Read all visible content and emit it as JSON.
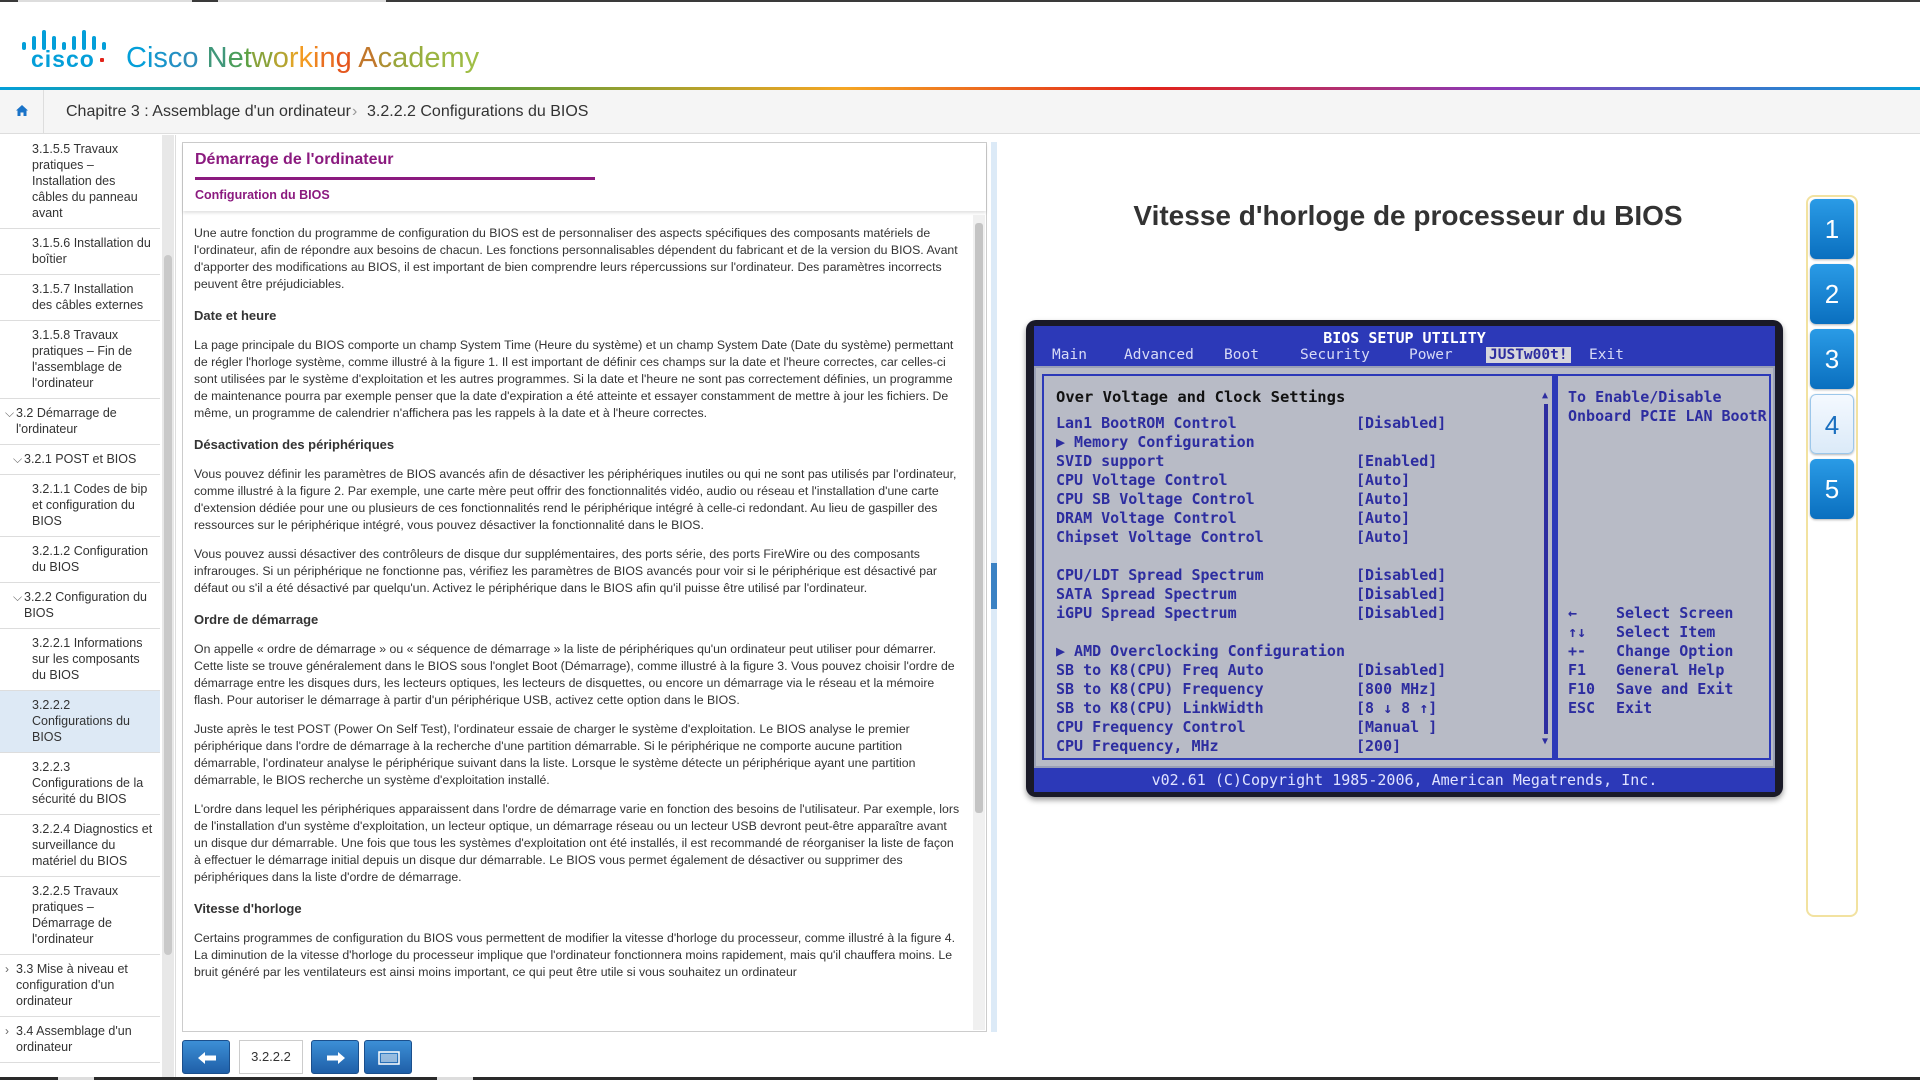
{
  "header": {
    "logo_word": "cisco",
    "academy_title": "Cisco Networking Academy",
    "brand_color": "#049fd9"
  },
  "breadcrumb": {
    "home_icon": "home-icon",
    "chapter": "Chapitre 3 : Assemblage d'un ordinateur",
    "separator": "›",
    "section": "3.2.2.2 Configurations du BIOS"
  },
  "sidebar": {
    "items": [
      {
        "label": "3.1.5.5 Travaux pratiques – Installation des câbles du panneau avant"
      },
      {
        "label": "3.1.5.6 Installation du boîtier"
      },
      {
        "label": "3.1.5.7 Installation des câbles externes"
      },
      {
        "label": "3.1.5.8 Travaux pratiques – Fin de l'assemblage de l'ordinateur"
      },
      {
        "label": "3.2 Démarrage de l'ordinateur",
        "chev": "⌵"
      },
      {
        "label": "3.2.1 POST et BIOS",
        "chev": "⌵"
      },
      {
        "label": "3.2.1.1 Codes de bip et configuration du BIOS"
      },
      {
        "label": "3.2.1.2 Configuration du BIOS"
      },
      {
        "label": "3.2.2 Configuration du BIOS",
        "chev": "⌵"
      },
      {
        "label": "3.2.2.1 Informations sur les composants du BIOS"
      },
      {
        "label": "3.2.2.2 Configurations du BIOS"
      },
      {
        "label": "3.2.2.3 Configurations de la sécurité du BIOS"
      },
      {
        "label": "3.2.2.4 Diagnostics et surveillance du matériel du BIOS"
      },
      {
        "label": "3.2.2.5 Travaux pratiques – Démarrage de l'ordinateur"
      },
      {
        "label": "3.3 Mise à niveau et configuration d'un ordinateur",
        "chev": "›"
      },
      {
        "label": "3.4 Assemblage d'un ordinateur",
        "chev": "›"
      }
    ]
  },
  "content": {
    "title": "Démarrage de l'ordinateur",
    "subtitle": "Configuration du BIOS",
    "p1": "Une autre fonction du programme de configuration du BIOS est de personnaliser des aspects spécifiques des composants matériels de l'ordinateur, afin de répondre aux besoins de chacun. Les fonctions personnalisables dépendent du fabricant et de la version du BIOS. Avant d'apporter des modifications au BIOS, il est important de bien comprendre leurs répercussions sur l'ordinateur. Des paramètres incorrects peuvent être préjudiciables.",
    "h1": "Date et heure",
    "p2": "La page principale du BIOS comporte un champ System Time (Heure du système) et un champ System Date (Date du système) permettant de régler l'horloge système, comme illustré à la figure 1. Il est important de définir ces champs sur la date et l'heure correctes, car celles-ci sont utilisées par le système d'exploitation et les autres programmes. Si la date et l'heure ne sont pas correctement définies, un programme de maintenance pourra par exemple penser que la date d'expiration a été atteinte et essayer constamment de mettre à jour les fichiers. De même, un programme de calendrier n'affichera pas les rappels à la date et à l'heure correctes.",
    "h2": "Désactivation des périphériques",
    "p3": "Vous pouvez définir les paramètres de BIOS avancés afin de désactiver les périphériques inutiles ou qui ne sont pas utilisés par l'ordinateur, comme illustré à la figure 2. Par exemple, une carte mère peut offrir des fonctionnalités vidéo, audio ou réseau et l'installation d'une carte d'extension dédiée pour une ou plusieurs de ces fonctionnalités rend le périphérique intégré à celle-ci redondant. Au lieu de gaspiller des ressources sur le périphérique intégré, vous pouvez désactiver la fonctionnalité dans le BIOS.",
    "p4": "Vous pouvez aussi désactiver des contrôleurs de disque dur supplémentaires, des ports série, des ports FireWire ou des composants infrarouges. Si un périphérique ne fonctionne pas, vérifiez les paramètres de BIOS avancés pour voir si le périphérique est désactivé par défaut ou s'il a été désactivé par quelqu'un. Activez le périphérique dans le BIOS afin qu'il puisse être utilisé par l'ordinateur.",
    "h3": "Ordre de démarrage",
    "p5": "On appelle « ordre de démarrage » ou « séquence de démarrage » la liste de périphériques qu'un ordinateur peut utiliser pour démarrer. Cette liste se trouve généralement dans le BIOS sous l'onglet Boot (Démarrage), comme illustré à la figure 3. Vous pouvez choisir l'ordre de démarrage entre les disques durs, les lecteurs optiques, les lecteurs de disquettes, ou encore un démarrage via le réseau et la mémoire flash. Pour autoriser le démarrage à partir d'un périphérique USB, activez cette option dans le BIOS.",
    "p6": "Juste après le test POST (Power On Self Test), l'ordinateur essaie de charger le système d'exploitation. Le BIOS analyse le premier périphérique dans l'ordre de démarrage à la recherche d'une partition démarrable. Si le périphérique ne comporte aucune partition démarrable, l'ordinateur analyse le périphérique suivant dans la liste. Lorsque le système détecte un périphérique ayant une partition démarrable, le BIOS recherche un système d'exploitation installé.",
    "p7": "L'ordre dans lequel les périphériques apparaissent dans l'ordre de démarrage varie en fonction des besoins de l'utilisateur. Par exemple, lors de l'installation d'un système d'exploitation, un lecteur optique, un démarrage réseau ou un lecteur USB devront peut-être apparaître avant un disque dur démarrable. Une fois que tous les systèmes d'exploitation ont été installés, il est recommandé de réorganiser la liste de façon à effectuer le démarrage initial depuis un disque dur démarrable. Le BIOS vous permet également de désactiver ou supprimer des périphériques dans la liste d'ordre de démarrage.",
    "h4": "Vitesse d'horloge",
    "p8": "Certains programmes de configuration du BIOS vous permettent de modifier la vitesse d'horloge du processeur, comme illustré à la figure 4. La diminution de la vitesse d'horloge du processeur implique que l'ordinateur fonctionnera moins rapidement, mais qu'il chauffera moins. Le bruit généré par les ventilateurs est ainsi moins important, ce qui peut être utile si vous souhaitez un ordinateur"
  },
  "pager": {
    "prev_icon": "arrow-left-icon",
    "page": "3.2.2.2",
    "next_icon": "arrow-right-icon",
    "screen_icon": "fullscreen-icon"
  },
  "figure": {
    "title": "Vitesse d'horloge de processeur du BIOS",
    "bios": {
      "title": "BIOS SETUP UTILITY",
      "tabs": [
        "Main",
        "Advanced",
        "Boot",
        "Security",
        "Power",
        "JUSTw00t!",
        "Exit"
      ],
      "selected_tab": "JUSTw00t!",
      "heading": "Over Voltage and Clock Settings",
      "rows": [
        {
          "label": "Lan1 BootROM Control",
          "value": "[Disabled]"
        },
        {
          "label": "▶ Memory Configuration",
          "value": ""
        },
        {
          "label": "SVID support",
          "value": "[Enabled]"
        },
        {
          "label": "CPU Voltage Control",
          "value": "[Auto]"
        },
        {
          "label": "CPU SB Voltage Control",
          "value": "[Auto]"
        },
        {
          "label": "DRAM Voltage Control",
          "value": "[Auto]"
        },
        {
          "label": "Chipset Voltage Control",
          "value": "[Auto]"
        },
        {
          "label": "CPU/LDT Spread Spectrum",
          "value": "[Disabled]"
        },
        {
          "label": "SATA Spread Spectrum",
          "value": "[Disabled]"
        },
        {
          "label": "iGPU Spread Spectrum",
          "value": "[Disabled]"
        },
        {
          "label": "▶ AMD Overclocking Configuration",
          "value": ""
        },
        {
          "label": "SB to K8(CPU) Freq Auto",
          "value": "[Disabled]"
        },
        {
          "label": "SB to K8(CPU) Frequency",
          "value": "[800 MHz]"
        },
        {
          "label": "SB to K8(CPU) LinkWidth",
          "value": "[8 ↓ 8 ↑]"
        },
        {
          "label": "CPU Frequency Control",
          "value": "[Manual ]"
        },
        {
          "label": "CPU Frequency, MHz",
          "value": "[200]"
        }
      ],
      "help_top": [
        "To Enable/Disable",
        "Onboard PCIE LAN BootR"
      ],
      "help_keys": [
        {
          "key": "←",
          "desc": "Select Screen"
        },
        {
          "key": "↑↓",
          "desc": "Select Item"
        },
        {
          "key": "+-",
          "desc": "Change Option"
        },
        {
          "key": "F1",
          "desc": "General Help"
        },
        {
          "key": "F10",
          "desc": "Save and Exit"
        },
        {
          "key": "ESC",
          "desc": "Exit"
        }
      ],
      "copyright": "v02.61 (C)Copyright 1985-2006, American Megatrends, Inc."
    }
  },
  "steps": {
    "labels": [
      "1",
      "2",
      "3",
      "4",
      "5"
    ],
    "current": "4"
  }
}
